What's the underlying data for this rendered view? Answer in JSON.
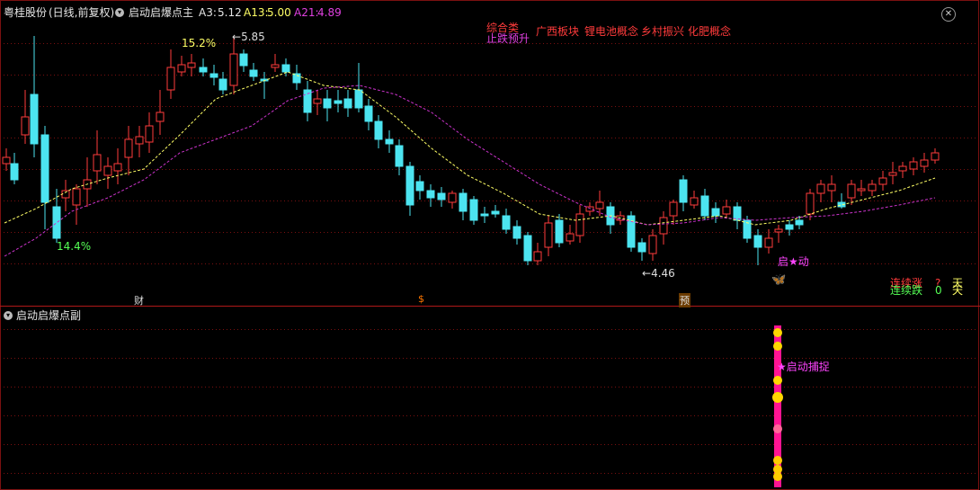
{
  "header": {
    "stock": "粤桂股份",
    "period": "(日线,前复权)",
    "indicator_main": "启动启爆点主",
    "a3_label": "A3:",
    "a3_value": "5.12",
    "a13_label": "A13:",
    "a13_value": "5.00",
    "a21_label": "A21:",
    "a21_value": "4.89",
    "indicator_sub": "启动启爆点副"
  },
  "concepts": {
    "tag1": "综合类",
    "tag2": "止跌预升",
    "items": [
      "广西板块",
      "锂电池概念",
      "乡村振兴",
      "化肥概念"
    ]
  },
  "annotations": {
    "high_pct": "15.2%",
    "high_price": "5.85",
    "low_pct": "14.4%",
    "low_price": "4.46",
    "start_label": "启★动",
    "capture_label": "★启动捕捉",
    "marker_cai": "财",
    "marker_dollar": "$",
    "marker_yu": "预"
  },
  "stats": {
    "up_label": "连续涨",
    "up_value": "?",
    "up_unit": "天",
    "down_label": "连续跌",
    "down_value": "0",
    "down_unit": "天"
  },
  "colors": {
    "up": "#ff3c3c",
    "down": "#4ce4f0",
    "ma1": "#ffff66",
    "ma2": "#cc33cc",
    "grid": "#7a1010",
    "pink": "#ff1493"
  },
  "chart_data": {
    "type": "candlestick",
    "high": 5.85,
    "low": 4.46
  }
}
